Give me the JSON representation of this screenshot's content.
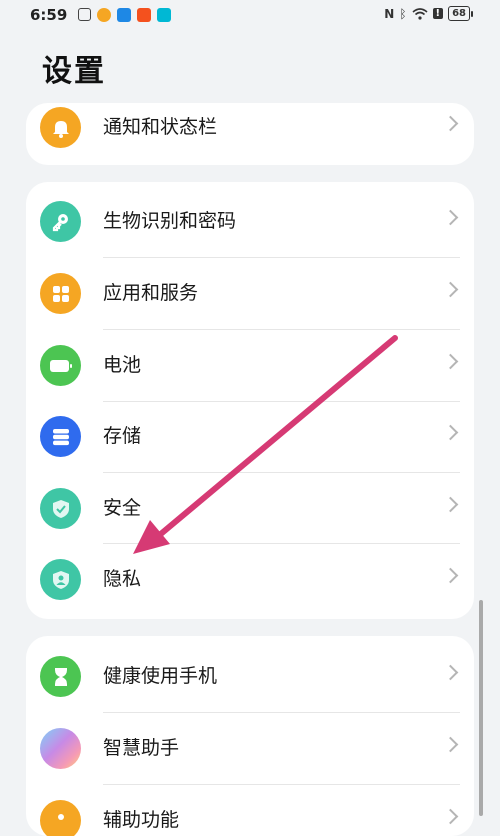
{
  "status_bar": {
    "time": "6:59",
    "battery": "68",
    "app_icons": [
      "rex-icon",
      "weibo-icon",
      "app-blue-icon",
      "app-orange-icon",
      "app-cyan-icon"
    ]
  },
  "page": {
    "title": "设置"
  },
  "groups": [
    {
      "items": [
        {
          "label": "通知和状态栏",
          "icon": "bell-icon",
          "color": "#F5A623"
        }
      ]
    },
    {
      "items": [
        {
          "label": "生物识别和密码",
          "icon": "key-icon",
          "color": "#3FC6A5"
        },
        {
          "label": "应用和服务",
          "icon": "grid-icon",
          "color": "#F5A623"
        },
        {
          "label": "电池",
          "icon": "battery-icon",
          "color": "#4CC552"
        },
        {
          "label": "存储",
          "icon": "storage-icon",
          "color": "#2F6BEE"
        },
        {
          "label": "安全",
          "icon": "shield-check-icon",
          "color": "#3FC6A5"
        },
        {
          "label": "隐私",
          "icon": "privacy-icon",
          "color": "#3FC6A5"
        }
      ]
    },
    {
      "items": [
        {
          "label": "健康使用手机",
          "icon": "hourglass-icon",
          "color": "#4CC552"
        },
        {
          "label": "智慧助手",
          "icon": "assistant-icon",
          "color": "#c78ae6"
        },
        {
          "label": "辅助功能",
          "icon": "accessibility-icon",
          "color": "#F5A623"
        }
      ]
    }
  ],
  "annotation": {
    "color": "#D63A74"
  }
}
